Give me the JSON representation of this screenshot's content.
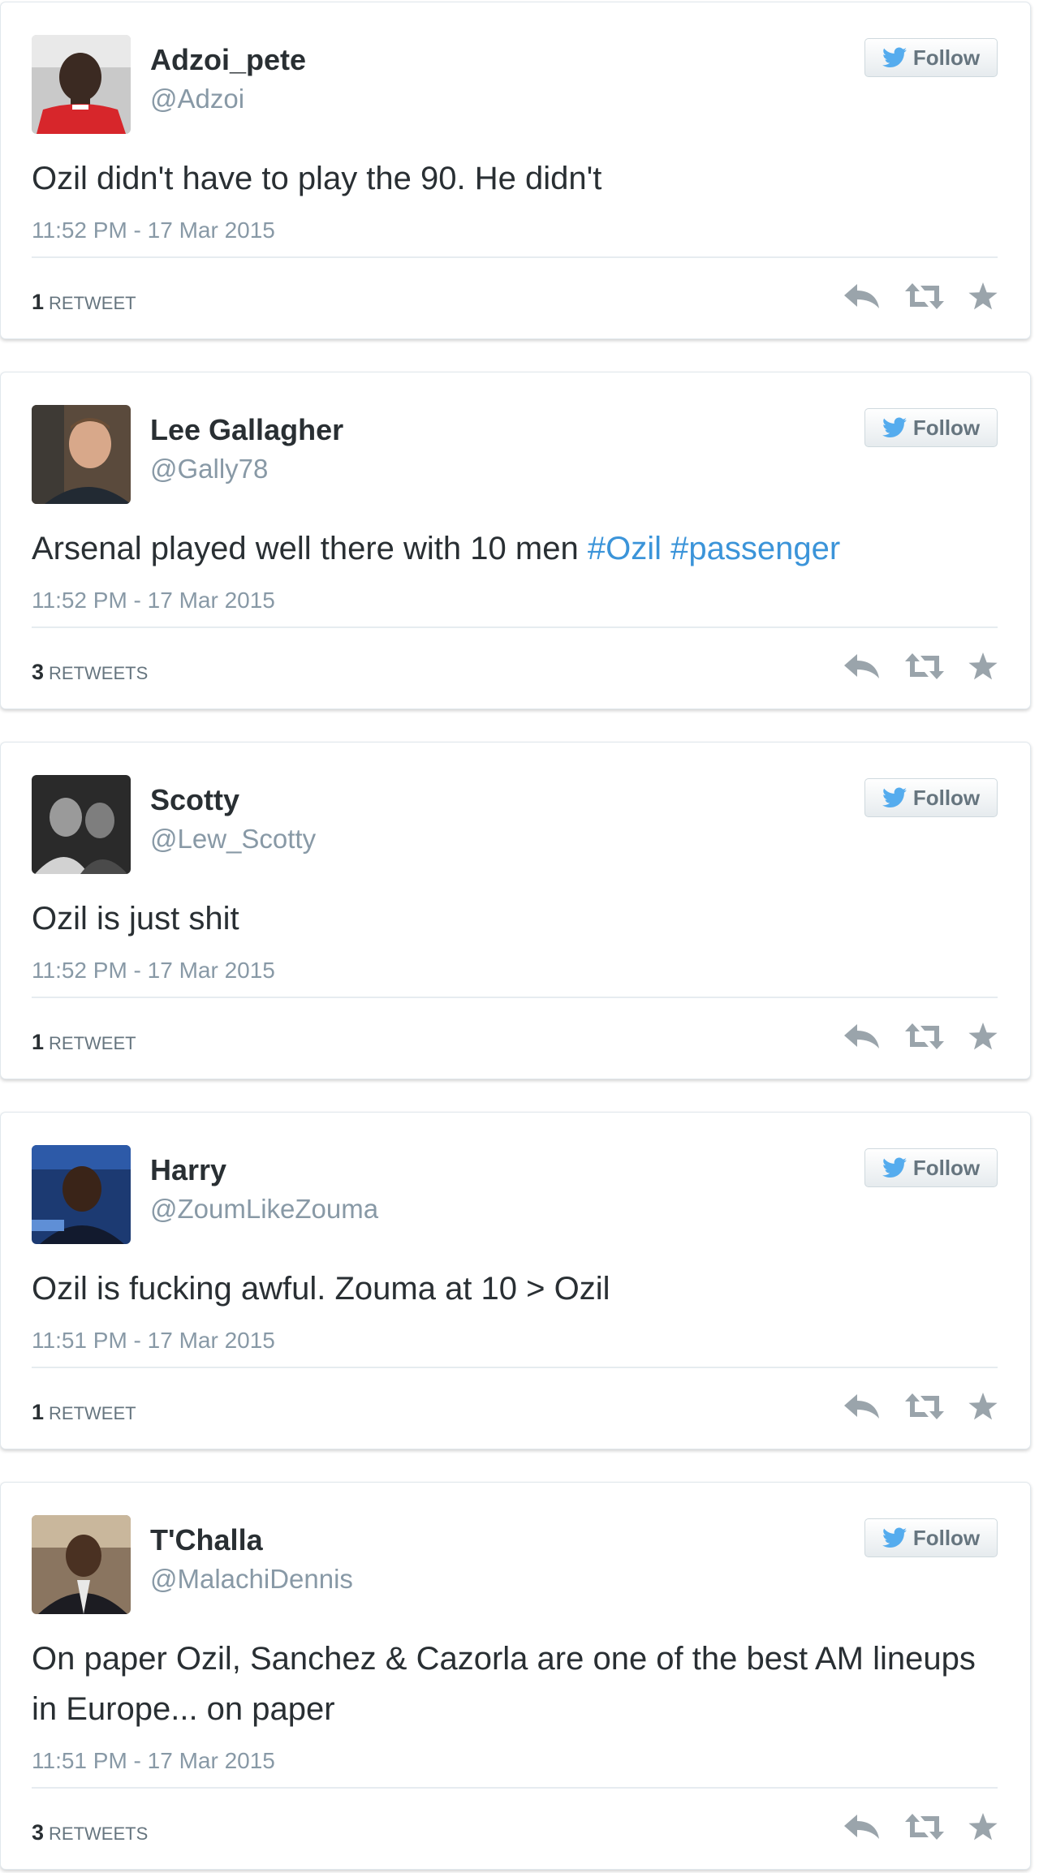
{
  "follow_label": "Follow",
  "colors": {
    "hashtag": "#3b94d9",
    "muted": "#8899a6",
    "action_icon": "#9aa4ab",
    "twitter_bird": "#55acee"
  },
  "icons": {
    "follow": "twitter-bird-icon",
    "reply": "reply-icon",
    "retweet": "retweet-icon",
    "favorite": "star-icon"
  },
  "tweets": [
    {
      "name": "Adzoi_pete",
      "handle": "@Adzoi",
      "text": "Ozil didn't have to play the 90. He didn't",
      "hashtags": [],
      "time": "11:52 PM - 17 Mar 2015",
      "retweet_count": "1",
      "retweet_label": "RETWEET"
    },
    {
      "name": "Lee Gallagher",
      "handle": "@Gally78",
      "text": "Arsenal played well there with 10 men",
      "hashtags": [
        "#Ozil",
        "#passenger"
      ],
      "time": "11:52 PM - 17 Mar 2015",
      "retweet_count": "3",
      "retweet_label": "RETWEETS"
    },
    {
      "name": "Scotty",
      "handle": "@Lew_Scotty",
      "text": "Ozil is just shit",
      "hashtags": [],
      "time": "11:52 PM - 17 Mar 2015",
      "retweet_count": "1",
      "retweet_label": "RETWEET"
    },
    {
      "name": "Harry",
      "handle": "@ZoumLikeZouma",
      "text": "Ozil is fucking awful. Zouma at 10 > Ozil",
      "hashtags": [],
      "time": "11:51 PM - 17 Mar 2015",
      "retweet_count": "1",
      "retweet_label": "RETWEET"
    },
    {
      "name": "T'Challa",
      "handle": "@MalachiDennis",
      "text": "On paper Ozil, Sanchez & Cazorla are one of the best AM lineups in Europe... on paper",
      "hashtags": [],
      "time": "11:51 PM - 17 Mar 2015",
      "retweet_count": "3",
      "retweet_label": "RETWEETS"
    }
  ]
}
